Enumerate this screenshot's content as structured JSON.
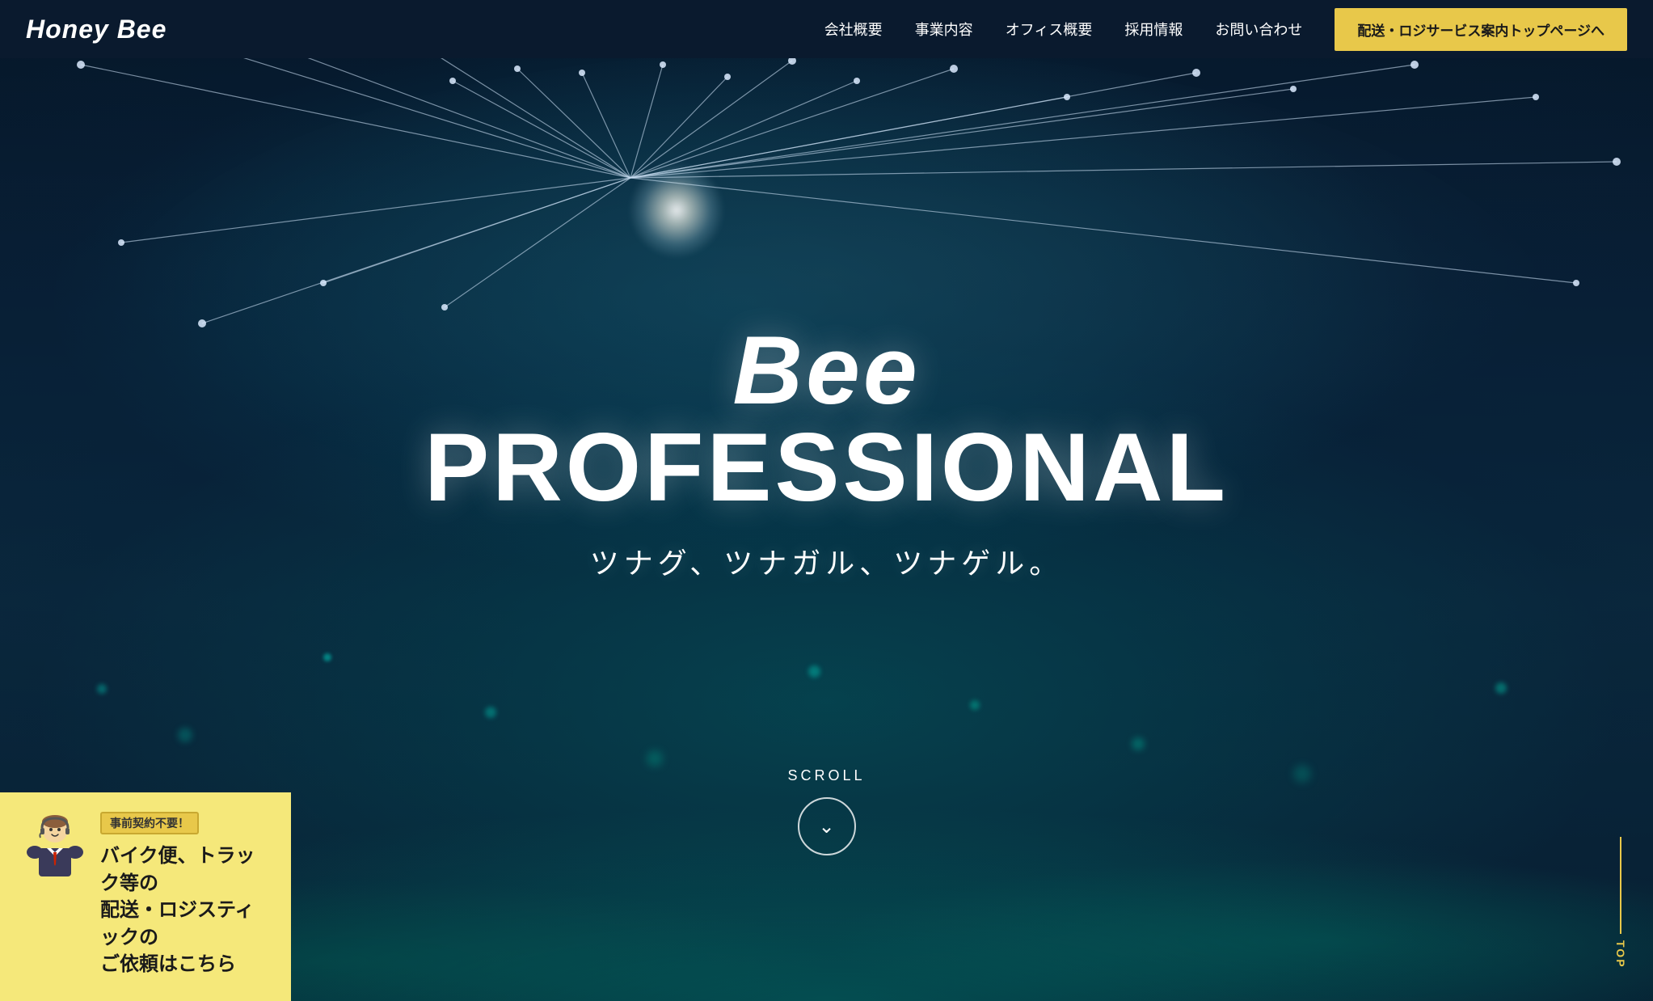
{
  "site": {
    "logo": "Honey Bee"
  },
  "header": {
    "nav": [
      {
        "label": "会社概要",
        "href": "#"
      },
      {
        "label": "事業内容",
        "href": "#"
      },
      {
        "label": "オフィス概要",
        "href": "#"
      },
      {
        "label": "採用情報",
        "href": "#"
      },
      {
        "label": "お問い合わせ",
        "href": "#"
      }
    ],
    "cta": "配送・ロジサービス案内トップページへ"
  },
  "hero": {
    "title_bee": "Bee",
    "title_pro": "PROFESSIONAL",
    "subtitle": "ツナグ、ツナガル、ツナゲル。",
    "scroll_label": "SCROLL"
  },
  "promo": {
    "badge": "事前契約不要！",
    "text": "バイク便、トラック等の\n配送・ロジスティックの\nご依頼はこちら"
  },
  "top_label": "TOP",
  "colors": {
    "accent": "#e8c84a",
    "header_bg": "#0a1a2e",
    "hero_bg": "#061525"
  }
}
